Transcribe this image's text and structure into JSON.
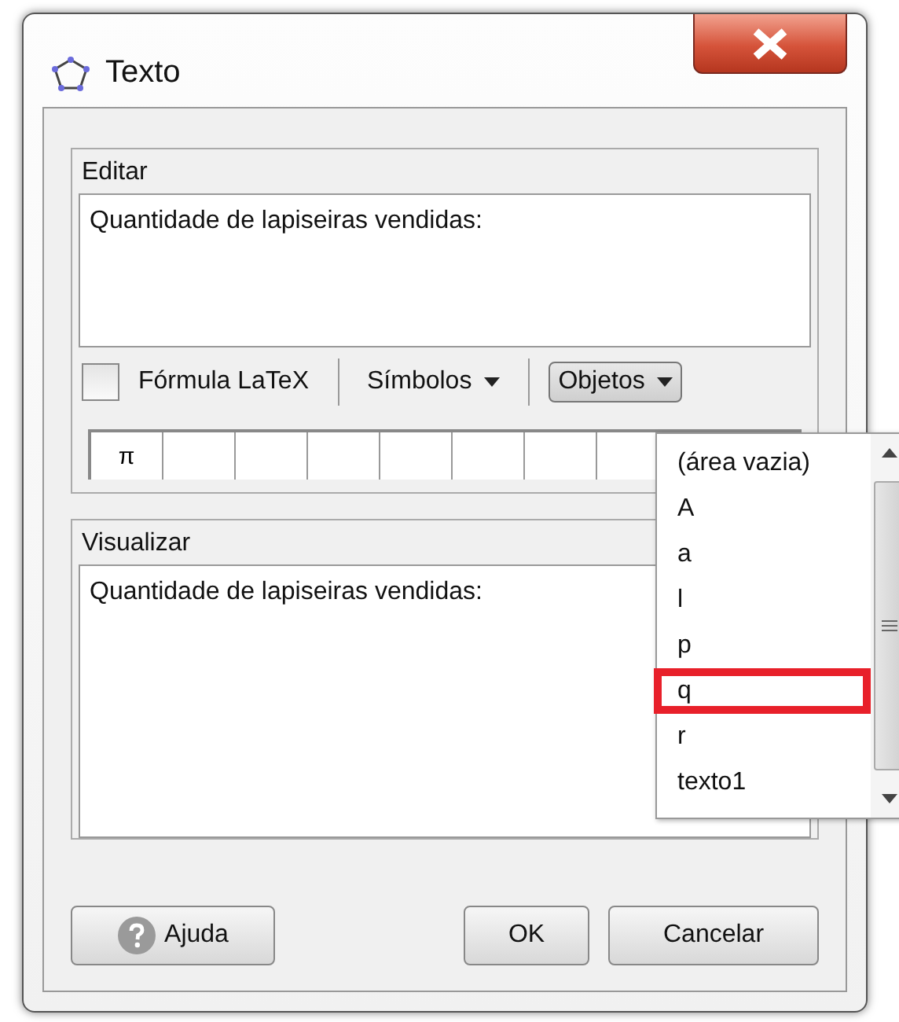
{
  "window": {
    "title": "Texto"
  },
  "edit": {
    "legend": "Editar",
    "text": "Quantidade de lapiseiras vendidas:"
  },
  "toolbar": {
    "latex": {
      "label": "Fórmula LaTeX",
      "checked": false
    },
    "symbols_menu": "Símbolos",
    "objects_menu": {
      "label": "Objetos",
      "open": true
    }
  },
  "symbols": [
    "π"
  ],
  "objects_list": [
    {
      "label": "(área vazia)",
      "marked": false
    },
    {
      "label": "A",
      "marked": false
    },
    {
      "label": "a",
      "marked": false
    },
    {
      "label": "l",
      "marked": false
    },
    {
      "label": "p",
      "marked": false
    },
    {
      "label": "q",
      "marked": true
    },
    {
      "label": "r",
      "marked": false
    },
    {
      "label": "texto1",
      "marked": false
    }
  ],
  "preview": {
    "legend": "Visualizar",
    "text": "Quantidade de lapiseiras vendidas:"
  },
  "buttons": [
    {
      "label": "Ajuda",
      "kind": "help"
    },
    {
      "label": "OK",
      "kind": "ok"
    },
    {
      "label": "Cancelar",
      "kind": "cancel"
    }
  ]
}
